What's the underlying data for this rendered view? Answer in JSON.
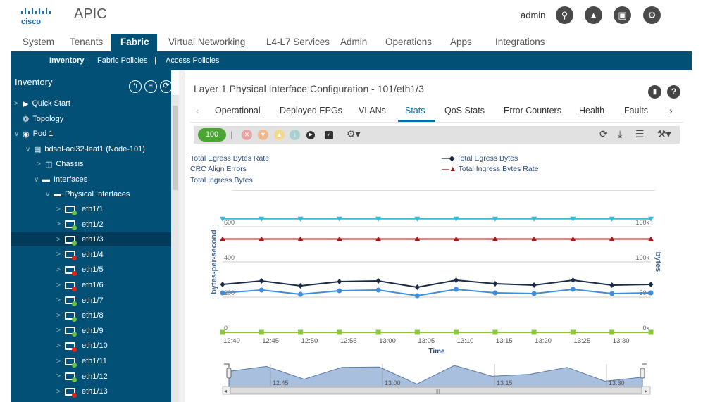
{
  "header": {
    "logo": "cisco",
    "app_title": "APIC",
    "user": "admin",
    "icons": [
      "search-icon",
      "bell-icon",
      "feedback-icon",
      "gear-icon"
    ]
  },
  "nav": {
    "tabs": [
      "System",
      "Tenants",
      "Fabric",
      "Virtual Networking",
      "L4-L7 Services",
      "Admin",
      "Operations",
      "Apps",
      "Integrations"
    ],
    "active": "Fabric"
  },
  "subnav": {
    "items": [
      "Inventory",
      "Fabric Policies",
      "Access Policies"
    ],
    "separator": "|",
    "active": "Inventory"
  },
  "sidebar": {
    "title": "Inventory",
    "tree": [
      {
        "label": "Quick Start",
        "icon": "quick-start-icon"
      },
      {
        "label": "Topology",
        "icon": "topology-icon"
      },
      {
        "label": "Pod 1",
        "icon": "pod-icon"
      },
      {
        "label": "bdsol-aci32-leaf1 (Node-101)",
        "icon": "switch-icon"
      },
      {
        "label": "Chassis",
        "icon": "chassis-icon"
      },
      {
        "label": "Interfaces",
        "icon": "folder-icon"
      },
      {
        "label": "Physical Interfaces",
        "icon": "folder-icon"
      }
    ],
    "interfaces": [
      {
        "label": "eth1/1",
        "status": "up"
      },
      {
        "label": "eth1/2",
        "status": "up"
      },
      {
        "label": "eth1/3",
        "status": "up",
        "selected": true
      },
      {
        "label": "eth1/4",
        "status": "down"
      },
      {
        "label": "eth1/5",
        "status": "down"
      },
      {
        "label": "eth1/6",
        "status": "down"
      },
      {
        "label": "eth1/7",
        "status": "up"
      },
      {
        "label": "eth1/8",
        "status": "up"
      },
      {
        "label": "eth1/9",
        "status": "up"
      },
      {
        "label": "eth1/10",
        "status": "down"
      },
      {
        "label": "eth1/11",
        "status": "up"
      },
      {
        "label": "eth1/12",
        "status": "up"
      },
      {
        "label": "eth1/13",
        "status": "down"
      }
    ]
  },
  "main": {
    "title": "Layer 1 Physical Interface Configuration - 101/eth1/3",
    "tabs": [
      "Operational",
      "Deployed EPGs",
      "VLANs",
      "Stats",
      "QoS Stats",
      "Error Counters",
      "Health",
      "Faults"
    ],
    "active_tab": "Stats",
    "health_score": "100"
  },
  "colors": {
    "brand": "#035077",
    "health": "#4aa532",
    "up": "#6cc04a",
    "down": "#e2231a"
  },
  "chart_data": {
    "type": "line",
    "x": [
      "12:40",
      "12:45",
      "12:50",
      "12:55",
      "13:00",
      "13:05",
      "13:10",
      "13:15",
      "13:20",
      "13:25",
      "13:30",
      "13:35"
    ],
    "tick_labels": [
      "12:40",
      "12:45",
      "12:50",
      "12:55",
      "13:00",
      "13:05",
      "13:10",
      "13:15",
      "13:20",
      "13:25",
      "13:30"
    ],
    "xlabel": "Time",
    "ylabel": "bytes-per-second",
    "y2label": "bytes",
    "yticks": [
      "0",
      "200",
      "400",
      "600"
    ],
    "y2ticks": [
      "0k",
      "50k",
      "100k",
      "150k"
    ],
    "ylim": [
      0,
      700
    ],
    "y2lim": [
      0,
      175000
    ],
    "grid": true,
    "legend": "top",
    "navigator_labels": [
      "12:45",
      "13:00",
      "13:15",
      "13:30"
    ],
    "series": [
      {
        "name": "Total Egress Bytes Rate",
        "axis": "left",
        "color": "#3bb8d8",
        "marker": "triangle-down",
        "values": [
          645,
          645,
          645,
          645,
          645,
          645,
          645,
          645,
          645,
          645,
          645,
          645
        ]
      },
      {
        "name": "CRC Align Errors",
        "axis": "left",
        "color": "#8cc63e",
        "marker": "square",
        "values": [
          0,
          0,
          0,
          0,
          0,
          0,
          0,
          0,
          0,
          0,
          0,
          0
        ]
      },
      {
        "name": "Total Ingress Bytes",
        "axis": "right",
        "color": "#3f8ddb",
        "marker": "circle",
        "values": [
          56000,
          60000,
          54000,
          59000,
          60000,
          52000,
          61000,
          56000,
          55000,
          61000,
          55000,
          56000
        ]
      },
      {
        "name": "Total Egress Bytes",
        "axis": "right",
        "color": "#1c2b45",
        "marker": "diamond",
        "values": [
          68000,
          73000,
          66000,
          72000,
          73000,
          64000,
          74000,
          69000,
          67000,
          74000,
          67000,
          68000
        ]
      },
      {
        "name": "Total Ingress Bytes Rate",
        "axis": "left",
        "color": "#a01c1c",
        "marker": "triangle",
        "values": [
          530,
          530,
          530,
          530,
          530,
          530,
          530,
          530,
          530,
          530,
          530,
          530
        ]
      }
    ]
  }
}
